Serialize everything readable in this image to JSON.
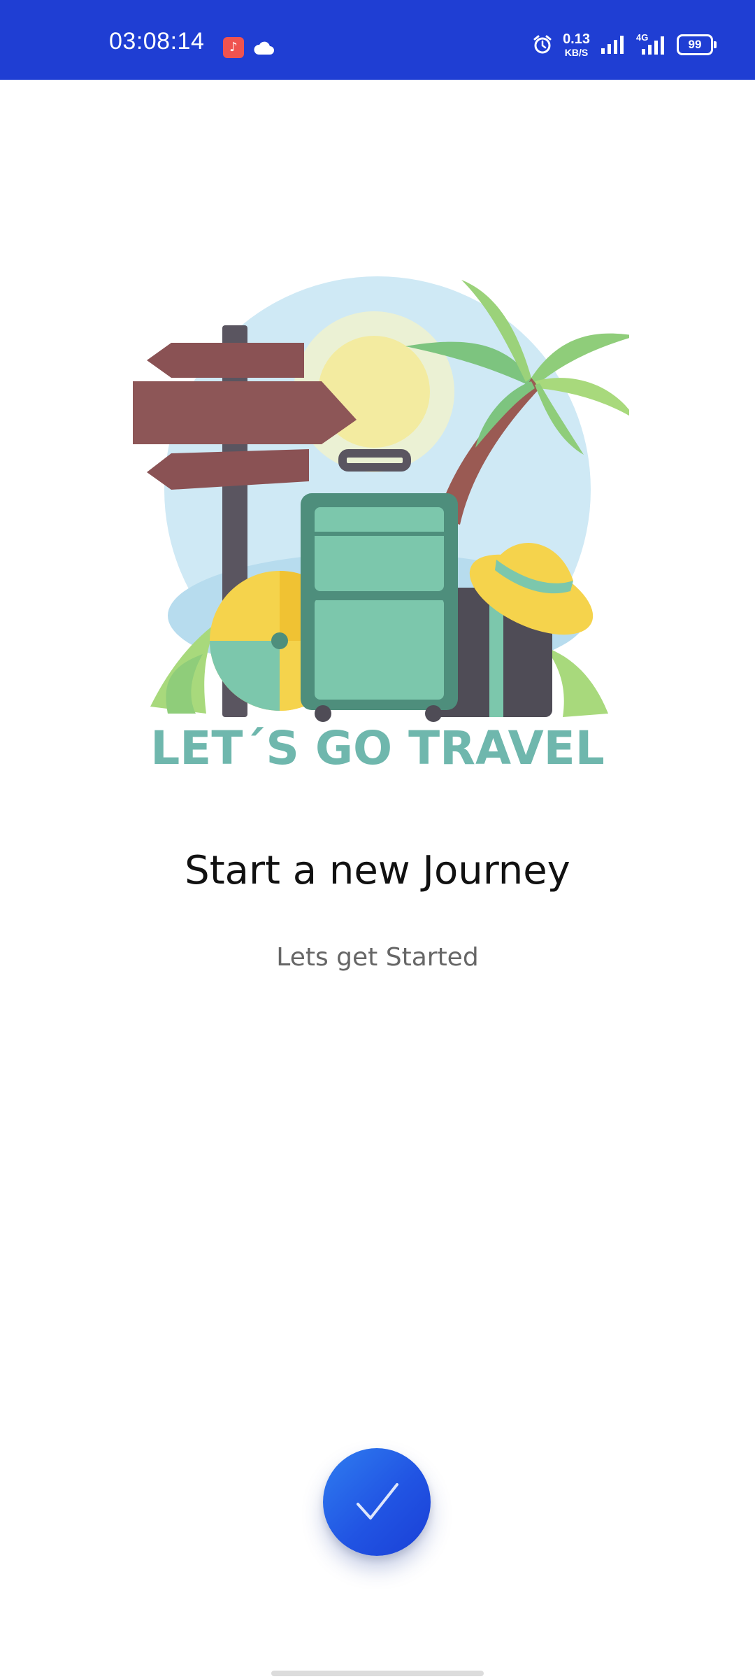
{
  "status_bar": {
    "time": "03:08:14",
    "music_icon": "music-note-icon",
    "cloud_icon": "cloud-icon",
    "alarm_icon": "alarm-icon",
    "net_speed_value": "0.13",
    "net_speed_unit": "KB/S",
    "network_type": "4G",
    "battery_level": "99",
    "background_color": "#1f3ed3"
  },
  "illustration": {
    "caption": "LET´S GO TRAVEL",
    "caption_color": "#6fb7ad"
  },
  "onboarding": {
    "title": "Start a new Journey",
    "subtitle": "Lets get Started"
  },
  "fab": {
    "icon": "check-icon",
    "color": "#2154e3"
  }
}
